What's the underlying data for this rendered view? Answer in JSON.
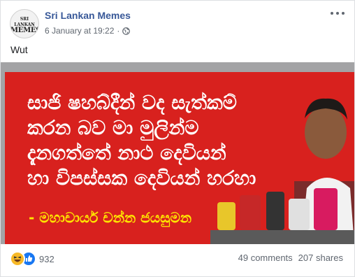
{
  "post": {
    "page_name": "Sri Lankan Memes",
    "avatar_line1": "SRI LANKAN",
    "avatar_line2": "MEMES",
    "date": "6 January at 19:22",
    "separator": "·",
    "privacy_icon": "globe-icon",
    "more_icon": "more-options-icon",
    "caption": "Wut"
  },
  "image": {
    "banner_lines": [
      "සාජි ෂහබ්දීන් වද සැත්කම්",
      "කරන බව මා මුලින්ම",
      "දැනගත්තේ නාථ දෙවියන්",
      "හා විපස්සක දෙවියන් හරහා"
    ],
    "author": "- මහාචාර්ය චන්න ජයසුමන"
  },
  "footer": {
    "reaction_icons": [
      "haha-icon",
      "like-icon"
    ],
    "reaction_count": "932",
    "comments": "49 comments",
    "shares": "207 shares"
  },
  "colors": {
    "page_name": "#385898",
    "banner_red": "#d8211e",
    "author_yellow": "#ffe600",
    "like_blue": "#1877f2",
    "haha_yellow": "#f7b928"
  }
}
